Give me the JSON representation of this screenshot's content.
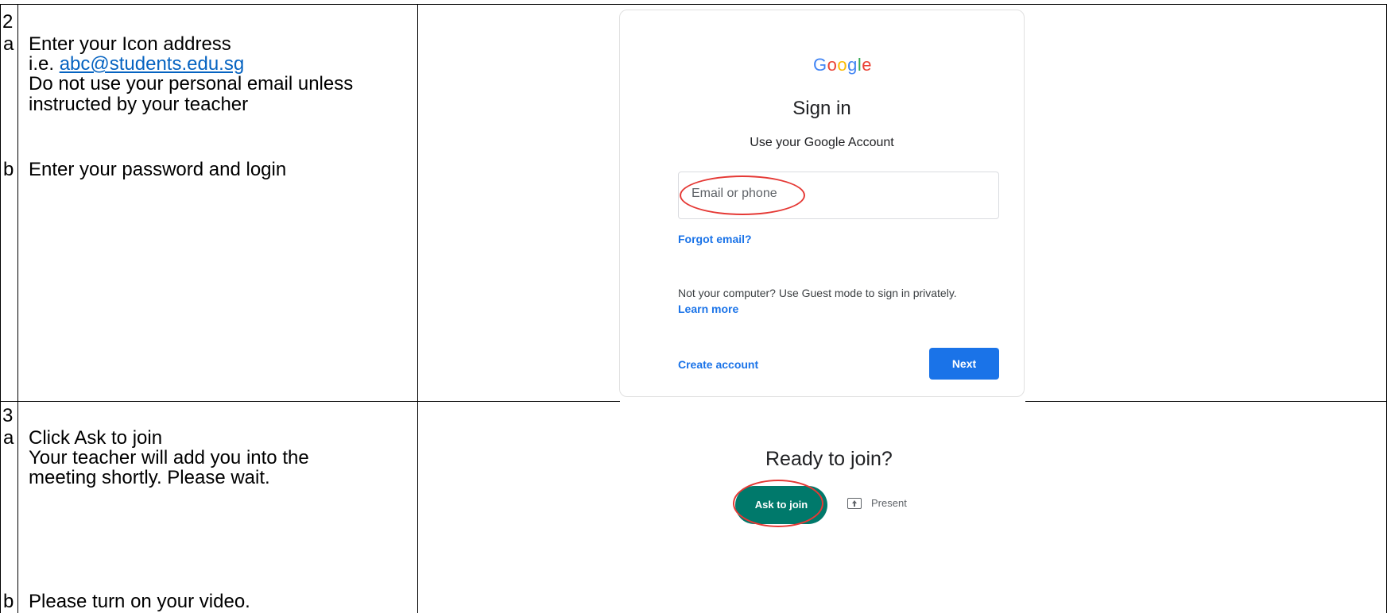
{
  "step2": {
    "number": "2",
    "sub_a": "a",
    "sub_b": "b",
    "line1": "Enter your Icon address",
    "line2_prefix": "i.e. ",
    "example_email": "abc@students.edu.sg",
    "line3": "Do not use your personal email unless",
    "line4": "instructed by your teacher",
    "line_b": "Enter your password and login"
  },
  "signin": {
    "logo_letters": [
      {
        "ch": "G",
        "color": "#4285f4"
      },
      {
        "ch": "o",
        "color": "#ea4335"
      },
      {
        "ch": "o",
        "color": "#fbbc05"
      },
      {
        "ch": "g",
        "color": "#4285f4"
      },
      {
        "ch": "l",
        "color": "#34a853"
      },
      {
        "ch": "e",
        "color": "#ea4335"
      }
    ],
    "title": "Sign in",
    "subtitle": "Use your Google Account",
    "email_placeholder": "Email or phone",
    "forgot": "Forgot email?",
    "guest_text": "Not your computer? Use Guest mode to sign in privately.",
    "learn_more": "Learn more",
    "create_account": "Create account",
    "next": "Next"
  },
  "step3": {
    "number": "3",
    "sub_a": "a",
    "sub_b": "b",
    "line1": "Click Ask to join",
    "line2": "Your teacher will add you into the",
    "line3": "meeting shortly. Please wait.",
    "line_b": "Please turn on your video."
  },
  "meet": {
    "ready": "Ready to join?",
    "ask_to_join": "Ask to join",
    "present": "Present",
    "present_icon": "present-screen-icon"
  },
  "colors": {
    "link": "#0563c1",
    "google_blue": "#1a73e8",
    "meet_green": "#00796b",
    "annotation_red": "#e53935"
  }
}
